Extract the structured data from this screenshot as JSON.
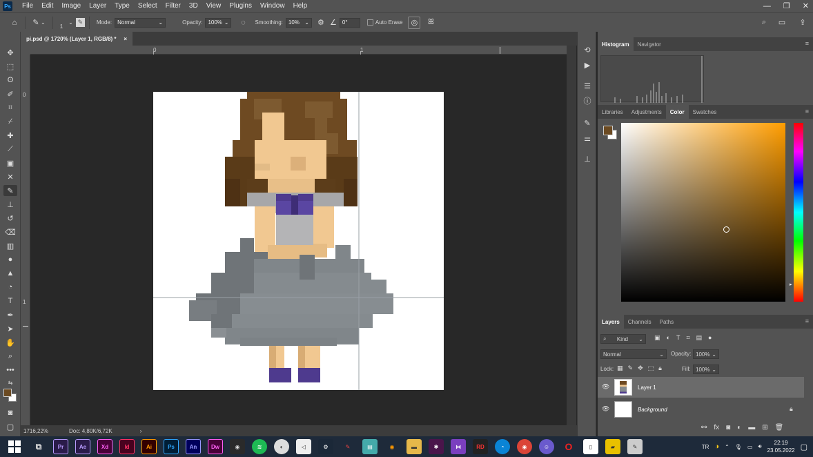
{
  "menubar": {
    "app_icon_label": "Ps",
    "items": [
      "File",
      "Edit",
      "Image",
      "Layer",
      "Type",
      "Select",
      "Filter",
      "3D",
      "View",
      "Plugins",
      "Window",
      "Help"
    ],
    "window_controls": [
      "—",
      "❐",
      "✕"
    ]
  },
  "options_bar": {
    "brush_size": "1",
    "mode_label": "Mode:",
    "mode_value": "Normal",
    "opacity_label": "Opacity:",
    "opacity_value": "100%",
    "smoothing_label": "Smoothing:",
    "smoothing_value": "10%",
    "angle_value": "0°",
    "auto_erase_label": "Auto Erase"
  },
  "document": {
    "tab_title": "pi.psd @ 1720% (Layer 1, RGB/8) *",
    "tab_close": "×",
    "ruler_top_labels": [
      "0",
      "1"
    ],
    "ruler_left_labels": [
      "0",
      "1"
    ],
    "zoom": "1716,22%",
    "doc_info": "Doc: 4,80K/6,72K",
    "status_arrow": "›"
  },
  "histogram_panel": {
    "tabs": [
      "Histogram",
      "Navigator"
    ],
    "active_tab": "Histogram"
  },
  "color_panel": {
    "tabs": [
      "Libraries",
      "Adjustments",
      "Color",
      "Swatches"
    ],
    "active_tab": "Color",
    "foreground_color": "#6b4a22",
    "background_color": "#ffffff"
  },
  "layers_panel": {
    "tabs": [
      "Layers",
      "Channels",
      "Paths"
    ],
    "active_tab": "Layers",
    "filter_label": "Kind",
    "blend_mode": "Normal",
    "opacity_label": "Opacity:",
    "opacity_value": "100%",
    "lock_label": "Lock:",
    "fill_label": "Fill:",
    "fill_value": "100%",
    "layers": [
      {
        "name": "Layer 1",
        "selected": true
      },
      {
        "name": "Background",
        "selected": false
      }
    ]
  },
  "taskbar": {
    "apps": [
      {
        "label": "Pr",
        "color": "#2a1b4a",
        "fg": "#b99cff"
      },
      {
        "label": "Ae",
        "color": "#2a1b4a",
        "fg": "#b99cff"
      },
      {
        "label": "Xd",
        "color": "#470137",
        "fg": "#ff61f6"
      },
      {
        "label": "Id",
        "color": "#49021f",
        "fg": "#ff3366"
      },
      {
        "label": "Ai",
        "color": "#330000",
        "fg": "#ff9a00"
      },
      {
        "label": "Ps",
        "color": "#001e36",
        "fg": "#31a8ff"
      },
      {
        "label": "An",
        "color": "#00005b",
        "fg": "#9999ff"
      },
      {
        "label": "Dw",
        "color": "#470137",
        "fg": "#ff61f6"
      }
    ],
    "language": "TR",
    "time": "22:19",
    "date": "23.05.2022"
  }
}
